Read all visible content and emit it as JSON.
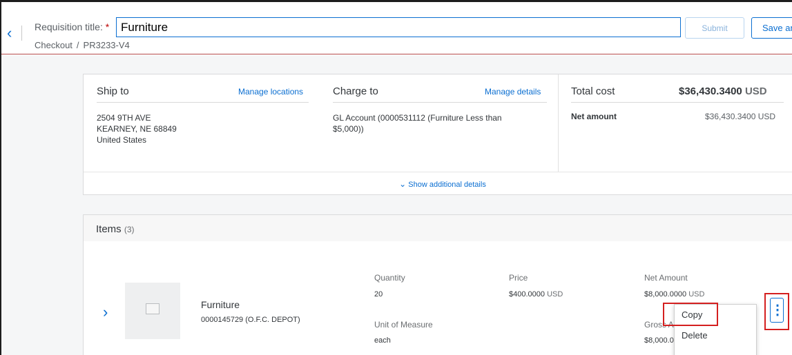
{
  "header": {
    "back_icon": "chevron-left-icon",
    "title_label": "Requisition title:",
    "required_marker": "*",
    "title_value": "Furniture",
    "breadcrumb": [
      "Checkout",
      "PR3233-V4"
    ],
    "breadcrumb_sep": "/",
    "submit_label": "Submit",
    "save_label": "Save an"
  },
  "summary": {
    "ship_to": {
      "title": "Ship to",
      "link": "Manage locations",
      "address": [
        "2504 9TH AVE",
        "KEARNEY, NE  68849",
        "United States"
      ]
    },
    "charge_to": {
      "title": "Charge to",
      "link": "Manage details",
      "account_line1": "GL Account (0000531112 (Furniture Less than",
      "account_line2": "$5,000))"
    },
    "total": {
      "title": "Total cost",
      "amount": "$36,430.3400",
      "currency": "USD",
      "net_label": "Net amount",
      "net_value": "$36,430.3400 USD"
    },
    "show_details": "Show additional details"
  },
  "items": {
    "title": "Items",
    "count": "(3)",
    "row": {
      "name": "Furniture",
      "supplier": "0000145729 (O.F.C. DEPOT)",
      "quantity_label": "Quantity",
      "quantity": "20",
      "uom_label": "Unit of Measure",
      "uom": "each",
      "price_label": "Price",
      "price": "$400.0000",
      "price_cur": "USD",
      "net_label": "Net Amount",
      "net": "$8,000.0000",
      "net_cur": "USD",
      "gross_label": "Gross A",
      "gross": "$8,000.0"
    }
  },
  "menu": {
    "copy": "Copy",
    "delete": "Delete"
  },
  "colors": {
    "accent": "#0a6ed1",
    "highlight": "#d41f1f",
    "header_rule": "#b54a4a"
  }
}
